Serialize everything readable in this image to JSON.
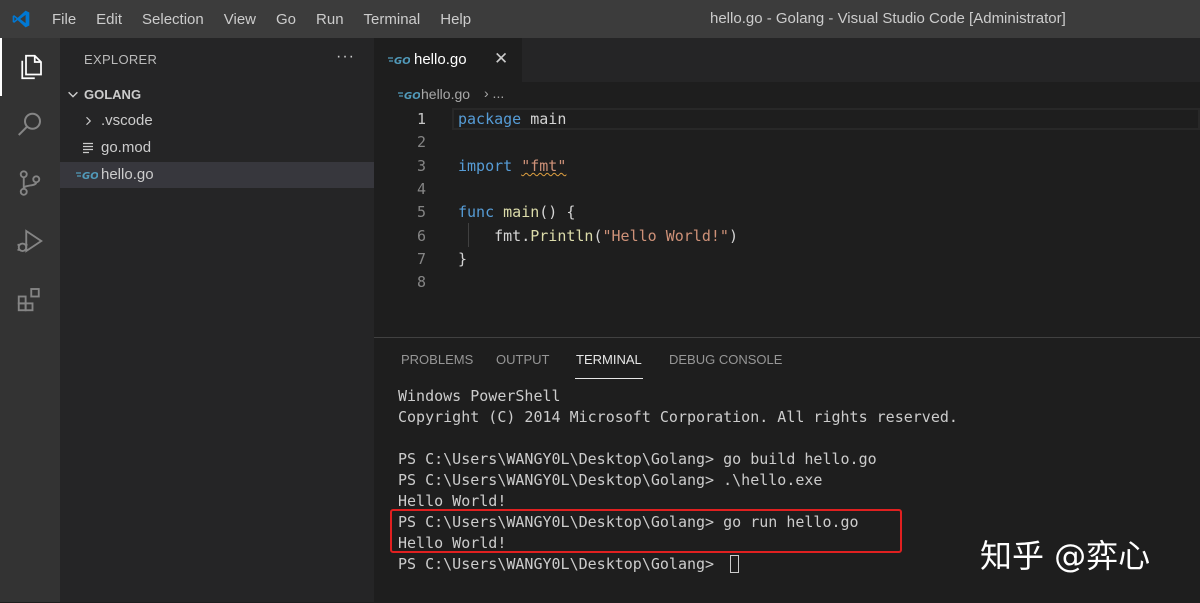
{
  "app": {
    "window_title": "hello.go - Golang - Visual Studio Code [Administrator]",
    "logo_icon": "vscode-logo-icon",
    "accent_color": "#0078d4"
  },
  "menu": [
    "File",
    "Edit",
    "Selection",
    "View",
    "Go",
    "Run",
    "Terminal",
    "Help"
  ],
  "activity_bar": [
    {
      "icon": "explorer-icon",
      "active": true
    },
    {
      "icon": "search-icon",
      "active": false
    },
    {
      "icon": "source-control-icon",
      "active": false
    },
    {
      "icon": "run-debug-icon",
      "active": false
    },
    {
      "icon": "extensions-icon",
      "active": false
    }
  ],
  "sidebar": {
    "title": "EXPLORER",
    "more_actions": "···",
    "folder": "GOLANG",
    "items": [
      {
        "label": ".vscode",
        "icon": "chevron-right-icon",
        "selected": false
      },
      {
        "label": "go.mod",
        "icon": "file-lines-icon",
        "selected": false
      },
      {
        "label": "hello.go",
        "icon": "go-file-icon",
        "selected": true
      }
    ]
  },
  "editor": {
    "tab": {
      "label": "hello.go",
      "close": "✕"
    },
    "breadcrumb": {
      "file": "hello.go",
      "rest": "› ..."
    },
    "line_numbers": [
      "1",
      "2",
      "3",
      "4",
      "5",
      "6",
      "7",
      "8"
    ],
    "code": {
      "l1_kw": "package",
      "l1_rest": " main",
      "l3_kw": "import",
      "l3_str": "\"fmt\"",
      "l5_kw": "func",
      "l5_fn": "main",
      "l5_rest": "() {",
      "l6_pkg": "fmt",
      "l6_dot": ".",
      "l6_fn": "Println",
      "l6_open": "(",
      "l6_str": "\"Hello World!\"",
      "l6_close": ")",
      "l7": "}"
    }
  },
  "panel": {
    "tabs": [
      "PROBLEMS",
      "OUTPUT",
      "TERMINAL",
      "DEBUG CONSOLE"
    ],
    "active_tab": "TERMINAL",
    "terminal_lines": [
      "Windows PowerShell",
      "Copyright (C) 2014 Microsoft Corporation. All rights reserved.",
      "",
      "PS C:\\Users\\WANGY0L\\Desktop\\Golang> go build hello.go",
      "PS C:\\Users\\WANGY0L\\Desktop\\Golang> .\\hello.exe",
      "Hello World!",
      "PS C:\\Users\\WANGY0L\\Desktop\\Golang> go run hello.go",
      "Hello World!",
      "PS C:\\Users\\WANGY0L\\Desktop\\Golang> "
    ],
    "highlight_color": "#e02020"
  },
  "watermark": "知乎 @弈心"
}
